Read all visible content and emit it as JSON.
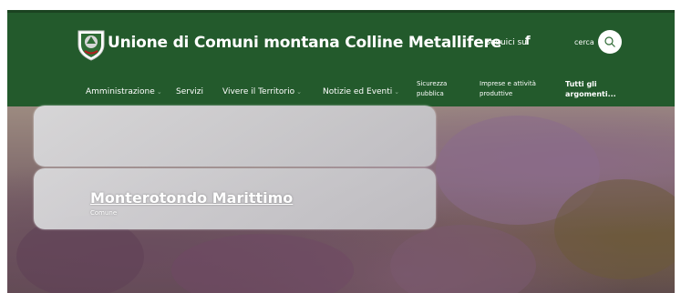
{
  "header": {
    "site_title": "Unione di Comuni montana Colline Metallifere",
    "follow_label": "Seguici su",
    "facebook_glyph": "f",
    "search_label": "cerca"
  },
  "nav": {
    "items": [
      {
        "label": "Amministrazione"
      },
      {
        "label": "Servizi"
      },
      {
        "label": "Vivere il Territorio"
      },
      {
        "label": "Notizie ed Eventi"
      }
    ],
    "security": {
      "line1": "Sicurezza",
      "line2": "pubblica"
    },
    "business": {
      "line1": "Imprese e attività",
      "line2": "produttive"
    },
    "all_topics": {
      "line1": "Tutti gli",
      "line2": "argomenti..."
    }
  },
  "hero": {
    "title": "Monterotondo Marittimo",
    "subtitle": "Comune"
  },
  "icons": {
    "logo": "crest-logo",
    "facebook": "facebook-icon",
    "search": "search-icon"
  },
  "colors": {
    "header_bg": "#235a2c",
    "accent": "#ffffff"
  }
}
